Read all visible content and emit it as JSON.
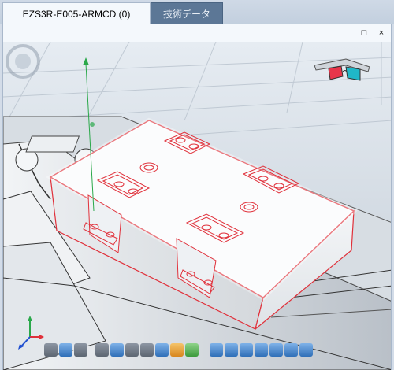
{
  "tabs": [
    {
      "label": "EZS3R-E005-ARMCD (0)",
      "active": true
    },
    {
      "label": "技術データ",
      "active": false
    }
  ],
  "window_controls": {
    "maximize": "□",
    "close": "×"
  },
  "colors": {
    "tab_active_bg": "#f4f8fc",
    "tab_inactive_bg": "#5c7796",
    "model_edge": "#e0303a",
    "viewport_bg": "#cfd6df"
  },
  "icons": {
    "view_cube": "compass-ring-icon",
    "anaglyph": "3d-glasses-icon",
    "axis_triad": "xyz-axis-icon",
    "toolbar": [
      "section-icon",
      "box-view-icon",
      "cylinder-icon",
      "zoom-icon",
      "zoom-fit-icon",
      "pan-icon",
      "rotate-icon",
      "measure-icon",
      "settings-icon",
      "render-icon",
      "cube-view-front-icon",
      "cube-view-top-icon",
      "cube-view-right-icon",
      "cube-view-iso1-icon",
      "cube-view-iso2-icon",
      "cube-view-iso3-icon",
      "cube-view-iso4-icon"
    ]
  }
}
